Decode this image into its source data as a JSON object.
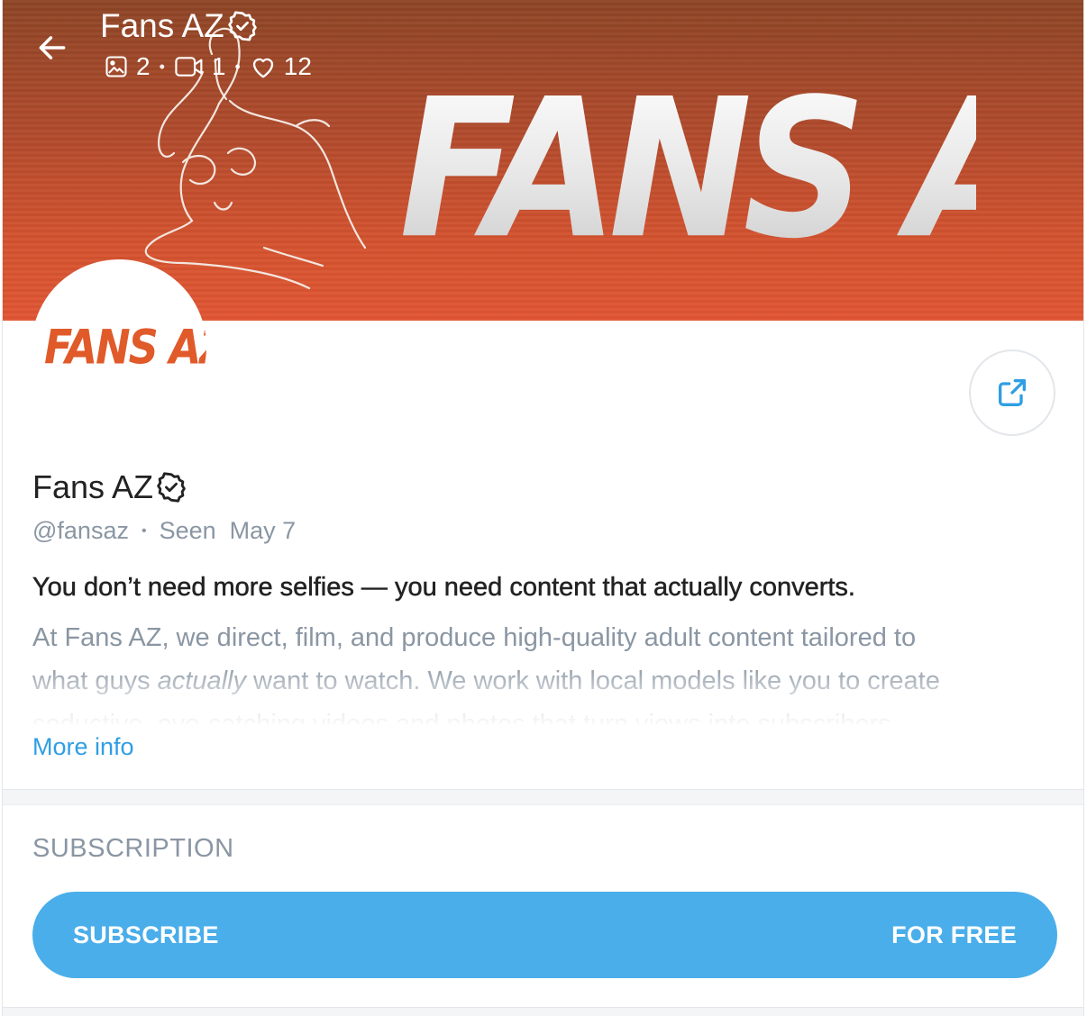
{
  "header": {
    "title": "Fans AZ",
    "stats": {
      "photos": "2",
      "videos": "1",
      "likes": "12"
    }
  },
  "cover": {
    "logo_text": "FANS AZ"
  },
  "avatar": {
    "logo_text": "FANS AZ"
  },
  "profile": {
    "name": "Fans AZ",
    "handle": "@fansaz",
    "seen_label": "Seen",
    "seen_date": "May 7",
    "bio_headline": "You don’t need more selfies — you need content that actually converts.",
    "bio_line1": "At Fans AZ, we direct, film, and produce high-quality adult content tailored to",
    "bio_line2_a": "what guys ",
    "bio_line2_em": "actually",
    "bio_line2_b": " want to watch. We work with local models like you to create",
    "bio_line3": "seductive, eye-catching videos and photos that turn views into subscribers.",
    "more_info": "More info"
  },
  "subscription": {
    "heading": "SUBSCRIPTION",
    "button_label": "SUBSCRIBE",
    "price_label": "FOR FREE"
  },
  "colors": {
    "accent": "#4aaeea",
    "link": "#2f9ee3",
    "muted": "#8a96a3",
    "cover_top": "#8e4526",
    "cover_bottom": "#e15634",
    "brand_orange": "#e05a2a"
  },
  "icons": {
    "back": "arrow-left-icon",
    "verified": "verified-badge-icon",
    "photos": "image-icon",
    "videos": "video-icon",
    "likes": "heart-icon",
    "share": "share-icon"
  }
}
